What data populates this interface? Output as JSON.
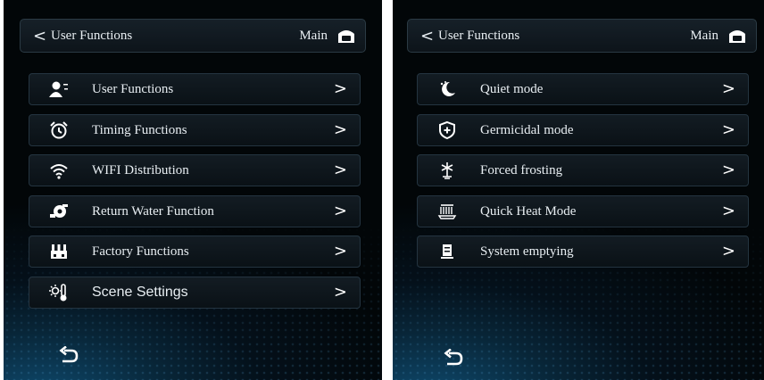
{
  "left": {
    "header": {
      "back": "<",
      "title": "User Functions",
      "main_label": "Main"
    },
    "items": [
      {
        "label": "User Functions",
        "icon": "user-settings-icon"
      },
      {
        "label": "Timing Functions",
        "icon": "alarm-clock-icon"
      },
      {
        "label": "WIFI Distribution",
        "icon": "wifi-icon"
      },
      {
        "label": "Return Water Function",
        "icon": "pump-icon"
      },
      {
        "label": "Factory Functions",
        "icon": "factory-icon"
      },
      {
        "label": "Scene Settings",
        "icon": "thermometer-sun-icon"
      }
    ],
    "arrow": ">"
  },
  "right": {
    "header": {
      "back": "<",
      "title": "User Functions",
      "main_label": "Main"
    },
    "items": [
      {
        "label": "Quiet mode",
        "icon": "moon-icon"
      },
      {
        "label": "Germicidal mode",
        "icon": "shield-plus-icon"
      },
      {
        "label": "Forced frosting",
        "icon": "snowflake-icon"
      },
      {
        "label": "Quick Heat Mode",
        "icon": "heating-icon"
      },
      {
        "label": "System emptying",
        "icon": "tank-icon"
      }
    ],
    "arrow": ">"
  },
  "icons": {
    "home": "home-icon",
    "undo": "undo-icon"
  }
}
